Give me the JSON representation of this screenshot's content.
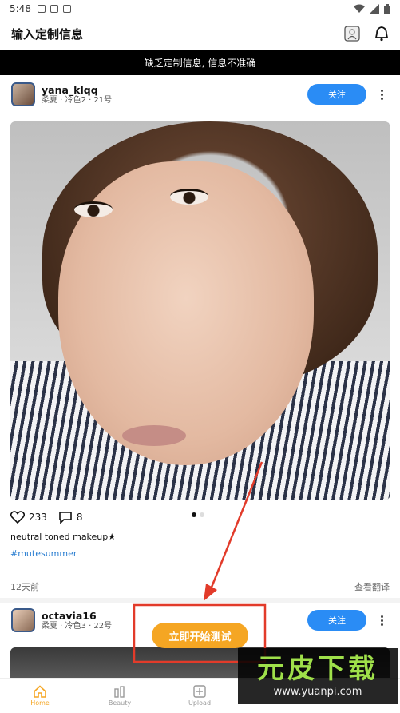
{
  "status_bar": {
    "time": "5:48"
  },
  "header": {
    "title": "输入定制信息"
  },
  "warning": {
    "text": "缺乏定制信息, 信息不准确"
  },
  "posts": [
    {
      "username": "yana_klqq",
      "meta": "柔夏 · 冷色2 · 21号",
      "follow_label": "关注",
      "likes": "233",
      "comments": "8",
      "caption": "neutral toned makeup★",
      "hashtag": "#mutesummer",
      "time_ago": "12天前",
      "translate_label": "查看翻译"
    },
    {
      "username": "octavia16",
      "meta": "柔夏 · 冷色3 · 22号",
      "follow_label": "关注"
    }
  ],
  "start_test_button": {
    "label": "立即开始测试"
  },
  "bottom_nav": [
    {
      "label": "Home",
      "icon": "home-icon",
      "active": true
    },
    {
      "label": "Beauty",
      "icon": "beauty-icon",
      "active": false
    },
    {
      "label": "Upload",
      "icon": "upload-icon",
      "active": false
    }
  ],
  "watermark": {
    "big_text": "元皮下载",
    "url": "www.yuanpi.com"
  },
  "colors": {
    "accent": "#f5a623",
    "follow_blue": "#2a8cf5",
    "annotation_red": "#e23b2a",
    "hashtag_blue": "#2a7ed1"
  },
  "carousel": {
    "current_page": 1,
    "total_pages": 2
  }
}
